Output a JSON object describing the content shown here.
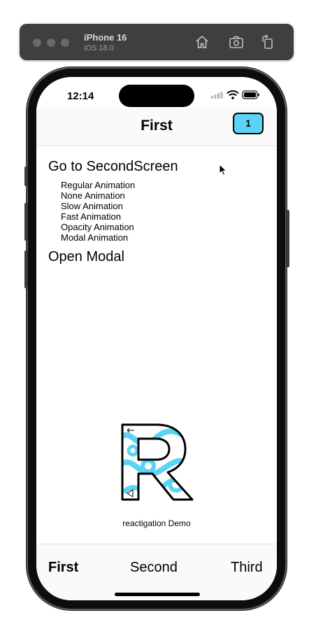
{
  "simulator": {
    "device_name": "iPhone 16",
    "os_version": "iOS 18.0",
    "icons": [
      "home-icon",
      "screenshot-icon",
      "rotate-icon"
    ]
  },
  "status_bar": {
    "time": "12:14",
    "icons": [
      "signal-icon",
      "wifi-icon",
      "battery-icon"
    ]
  },
  "header": {
    "title": "First",
    "badge": "1"
  },
  "main": {
    "go_to_second": "Go to SecondScreen",
    "animations": [
      "Regular Animation",
      "None Animation",
      "Slow Animation",
      "Fast Animation",
      "Opacity Animation",
      "Modal Animation"
    ],
    "open_modal": "Open Modal",
    "logo_caption": "reactigation Demo"
  },
  "tabs": [
    {
      "label": "First",
      "active": true
    },
    {
      "label": "Second",
      "active": false
    },
    {
      "label": "Third",
      "active": false
    }
  ],
  "colors": {
    "accent": "#5ad4f5",
    "badge_border": "#000000",
    "toolbar": "#3f3f3f"
  }
}
